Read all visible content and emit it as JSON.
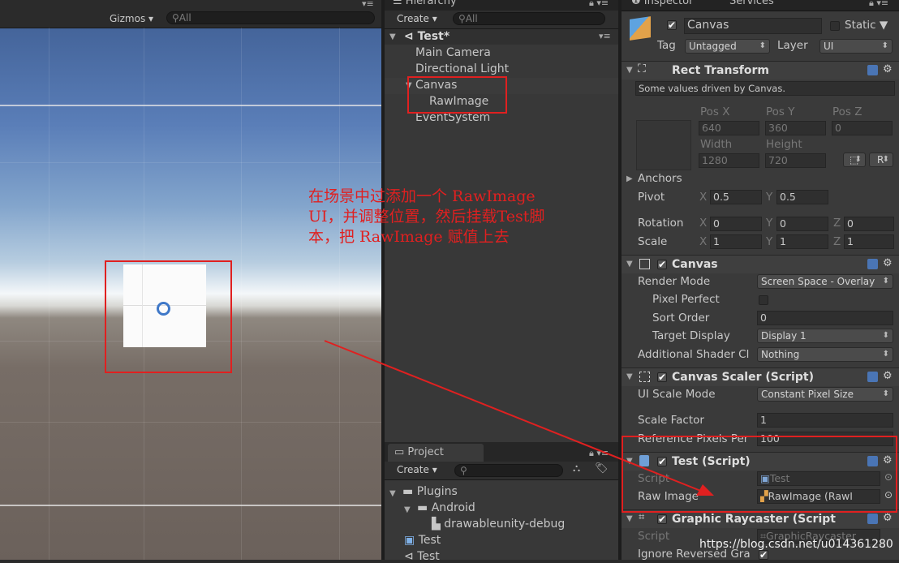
{
  "scene": {
    "gizmos_label": "Gizmos",
    "search_placeholder": "All"
  },
  "hierarchy": {
    "tab_label": "Hierarchy",
    "create_label": "Create",
    "search_placeholder": "All",
    "scene_name": "Test*",
    "items": [
      "Main Camera",
      "Directional Light",
      "Canvas",
      "RawImage",
      "EventSystem"
    ]
  },
  "project": {
    "tab_label": "Project",
    "create_label": "Create",
    "items": [
      "Plugins",
      "Android",
      "drawableunity-debug",
      "Test",
      "Test"
    ]
  },
  "inspector": {
    "tab_label": "Inspector",
    "services_label": "Services",
    "object_name": "Canvas",
    "static_label": "Static",
    "tag_label": "Tag",
    "tag_value": "Untagged",
    "layer_label": "Layer",
    "layer_value": "UI",
    "rect_transform": {
      "title": "Rect Transform",
      "note": "Some values driven by Canvas.",
      "pos_x_label": "Pos X",
      "pos_y_label": "Pos Y",
      "pos_z_label": "Pos Z",
      "pos_x": "640",
      "pos_y": "360",
      "pos_z": "0",
      "width_label": "Width",
      "height_label": "Height",
      "width": "1280",
      "height": "720",
      "r_label": "R",
      "anchors_label": "Anchors",
      "pivot_label": "Pivot",
      "pivot_x": "0.5",
      "pivot_y": "0.5",
      "rotation_label": "Rotation",
      "rot_x": "0",
      "rot_y": "0",
      "rot_z": "0",
      "scale_label": "Scale",
      "scale_x": "1",
      "scale_y": "1",
      "scale_z": "1",
      "x": "X",
      "y": "Y",
      "z": "Z"
    },
    "canvas": {
      "title": "Canvas",
      "render_mode_label": "Render Mode",
      "render_mode_value": "Screen Space - Overlay",
      "pixel_perfect_label": "Pixel Perfect",
      "sort_order_label": "Sort Order",
      "sort_order_value": "0",
      "target_display_label": "Target Display",
      "target_display_value": "Display 1",
      "additional_label": "Additional Shader Cl",
      "additional_value": "Nothing"
    },
    "canvas_scaler": {
      "title": "Canvas Scaler (Script)",
      "ui_scale_mode_label": "UI Scale Mode",
      "ui_scale_mode_value": "Constant Pixel Size",
      "scale_factor_label": "Scale Factor",
      "scale_factor_value": "1",
      "ref_pixels_label": "Reference Pixels Per",
      "ref_pixels_value": "100"
    },
    "test_script": {
      "title": "Test (Script)",
      "script_label": "Script",
      "script_value": "Test",
      "raw_image_label": "Raw Image",
      "raw_image_value": "RawImage (RawI"
    },
    "graphic_raycaster": {
      "title": "Graphic Raycaster (Script",
      "script_label": "Script",
      "script_value": "GraphicRaycaster",
      "ignore_label": "Ignore Reversed Gra"
    }
  },
  "annotation": {
    "text": "在场景中过添加一个 RawImage\nUI，并调整位置，然后挂载Test脚\n本，把 RawImage 赋值上去"
  },
  "watermark": "https://blog.csdn.net/u014361280"
}
